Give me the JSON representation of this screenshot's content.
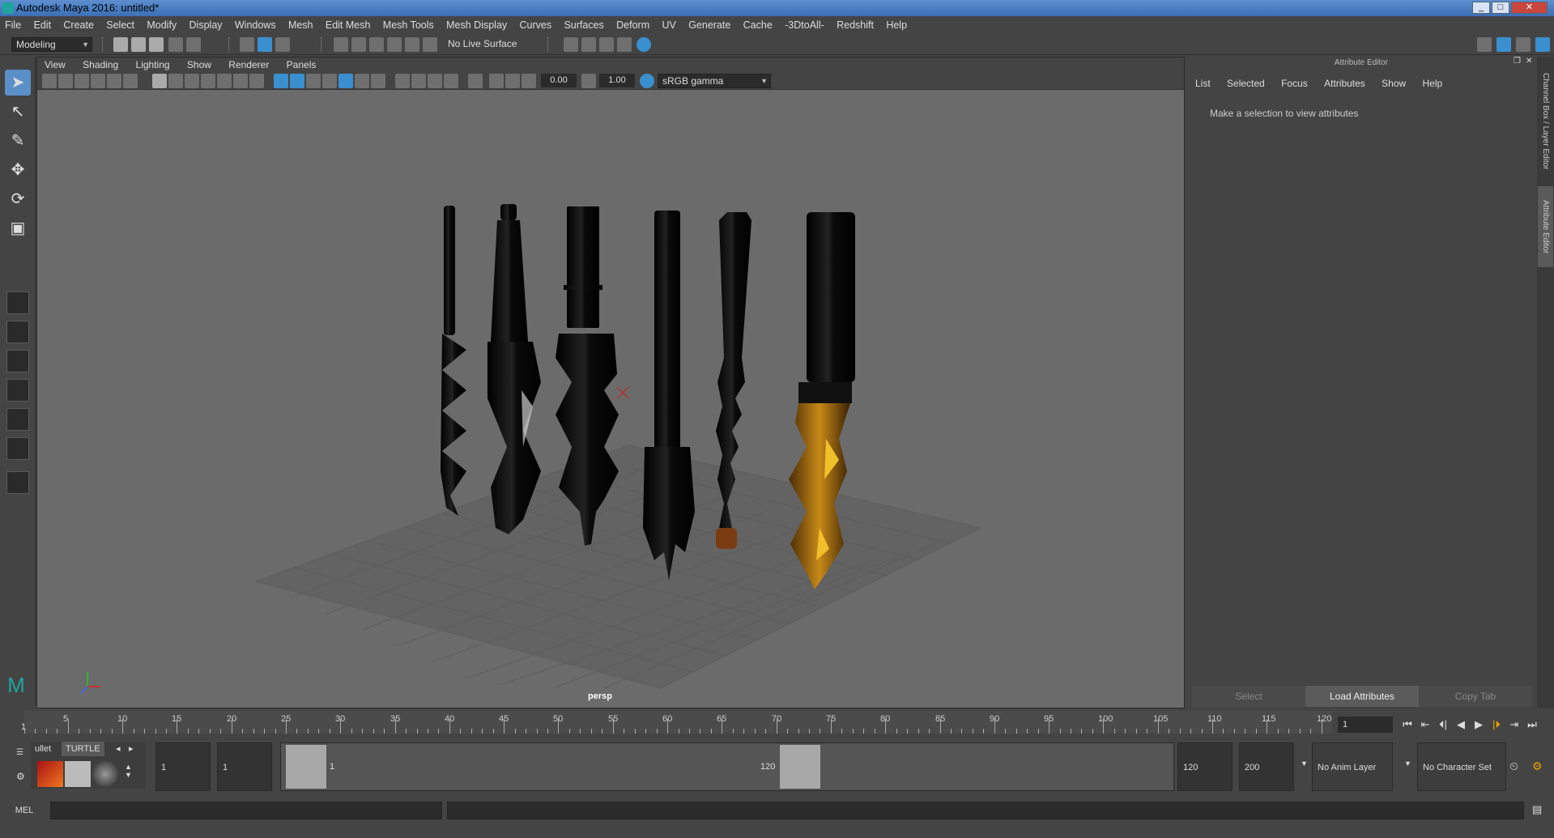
{
  "window": {
    "title": "Autodesk Maya 2016: untitled*",
    "controls": [
      "_",
      "□",
      "✕"
    ]
  },
  "menubar": [
    "File",
    "Edit",
    "Create",
    "Select",
    "Modify",
    "Display",
    "Windows",
    "Mesh",
    "Edit Mesh",
    "Mesh Tools",
    "Mesh Display",
    "Curves",
    "Surfaces",
    "Deform",
    "UV",
    "Generate",
    "Cache",
    "-3DtoAll-",
    "Redshift",
    "Help"
  ],
  "statusline": {
    "mode": "Modeling",
    "live_surface": "No Live Surface"
  },
  "viewport": {
    "menu": [
      "View",
      "Shading",
      "Lighting",
      "Show",
      "Renderer",
      "Panels"
    ],
    "exposure": "0.00",
    "gamma": "1.00",
    "colorspace": "sRGB gamma",
    "camera_label": "persp"
  },
  "attribute_editor": {
    "title": "Attribute Editor",
    "menu": [
      "List",
      "Selected",
      "Focus",
      "Attributes",
      "Show",
      "Help"
    ],
    "message": "Make a selection to view attributes",
    "buttons": [
      "Select",
      "Load Attributes",
      "Copy Tab"
    ],
    "side_tabs": [
      "Channel Box / Layer Editor",
      "Attribute Editor"
    ]
  },
  "timeline": {
    "ticks": [
      "5",
      "10",
      "15",
      "20",
      "25",
      "30",
      "35",
      "40",
      "45",
      "50",
      "55",
      "60",
      "65",
      "70",
      "75",
      "80",
      "85",
      "90",
      "95",
      "100",
      "105",
      "110",
      "115",
      "120"
    ],
    "start_label": "1",
    "current_frame": "1",
    "playback": [
      "⏮",
      "⇤",
      "⏴|",
      "◀",
      "▶",
      "|⏵",
      "⇥",
      "⏭"
    ]
  },
  "range": {
    "anim_start": "1",
    "play_start": "1",
    "range_start_label": "1",
    "range_end_label": "120",
    "play_end": "120",
    "anim_end": "200",
    "anim_layer": "No Anim Layer",
    "character_set": "No Character Set"
  },
  "shelf": {
    "tabs": [
      "ullet",
      "TURTLE"
    ]
  },
  "commandline": {
    "label": "MEL"
  },
  "colors": {
    "bronze": "#8a5a10",
    "black_metal": "#0d0d0d",
    "grid": "#5a5a5a",
    "accent": "#5a8fc8"
  }
}
